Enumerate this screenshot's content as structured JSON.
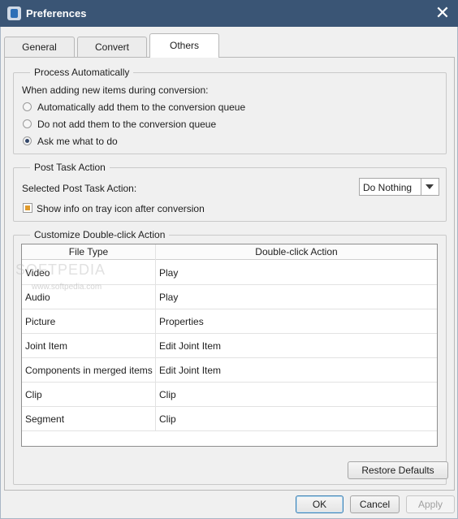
{
  "window": {
    "title": "Preferences"
  },
  "tabs": [
    {
      "label": "General",
      "active": false
    },
    {
      "label": "Convert",
      "active": false
    },
    {
      "label": "Others",
      "active": true
    }
  ],
  "process_automatically": {
    "legend": "Process Automatically",
    "prompt": "When adding new items during conversion:",
    "options": [
      {
        "label": "Automatically add them to the conversion queue",
        "selected": false
      },
      {
        "label": "Do not add them to the conversion queue",
        "selected": false
      },
      {
        "label": "Ask me what to do",
        "selected": true
      }
    ]
  },
  "post_task": {
    "legend": "Post Task Action",
    "selected_label": "Selected Post Task Action:",
    "selected_value": "Do Nothing",
    "tray_checkbox_label": "Show info on tray icon after conversion",
    "tray_checked": true
  },
  "double_click": {
    "legend": "Customize Double-click Action",
    "columns": [
      "File Type",
      "Double-click Action"
    ],
    "rows": [
      [
        "Video",
        "Play"
      ],
      [
        "Audio",
        "Play"
      ],
      [
        "Picture",
        "Properties"
      ],
      [
        "Joint Item",
        "Edit Joint Item"
      ],
      [
        "Components in merged items",
        "Edit Joint Item"
      ],
      [
        "Clip",
        "Clip"
      ],
      [
        "Segment",
        "Clip"
      ]
    ]
  },
  "buttons": {
    "restore_defaults": "Restore Defaults",
    "ok": "OK",
    "cancel": "Cancel",
    "apply": "Apply"
  },
  "watermark": {
    "text": "SOFTPEDIA",
    "sub": "www.softpedia.com"
  },
  "colors": {
    "titlebar": "#3a5575",
    "checkbox_accent": "#e09a2c"
  }
}
